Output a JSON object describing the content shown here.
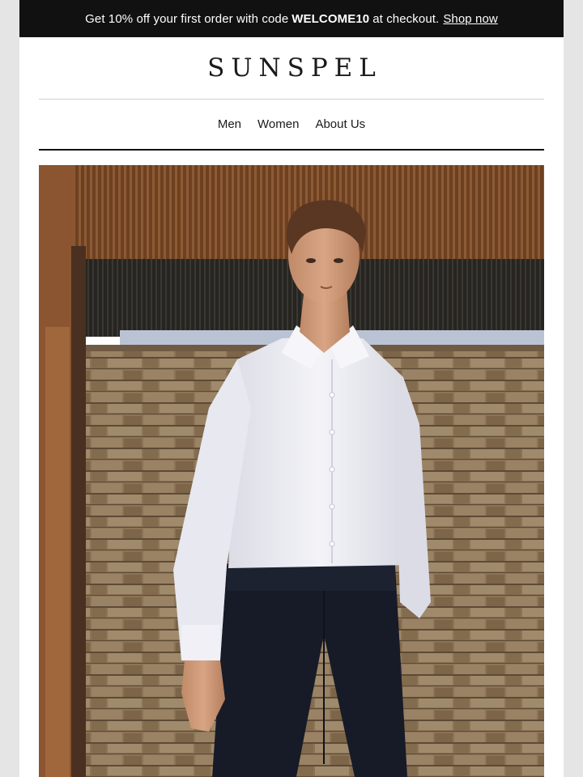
{
  "promo_bar": {
    "text": "Get 10% off your first order with code",
    "code": "WELCOME10",
    "suffix": "at checkout.",
    "link_label": "Shop now"
  },
  "brand": {
    "logo_text": "SUNSPEL"
  },
  "nav": {
    "items": [
      {
        "label": "Men"
      },
      {
        "label": "Women"
      },
      {
        "label": "About Us"
      }
    ]
  },
  "hero": {
    "subject": "model-in-white-shirt-and-navy-trousers",
    "colors": {
      "ceiling": "#7a4a28",
      "wall": "#8f7658",
      "shirt": "#eeeef4",
      "trousers": "#181c28",
      "wood_post": "#8a5530"
    }
  }
}
